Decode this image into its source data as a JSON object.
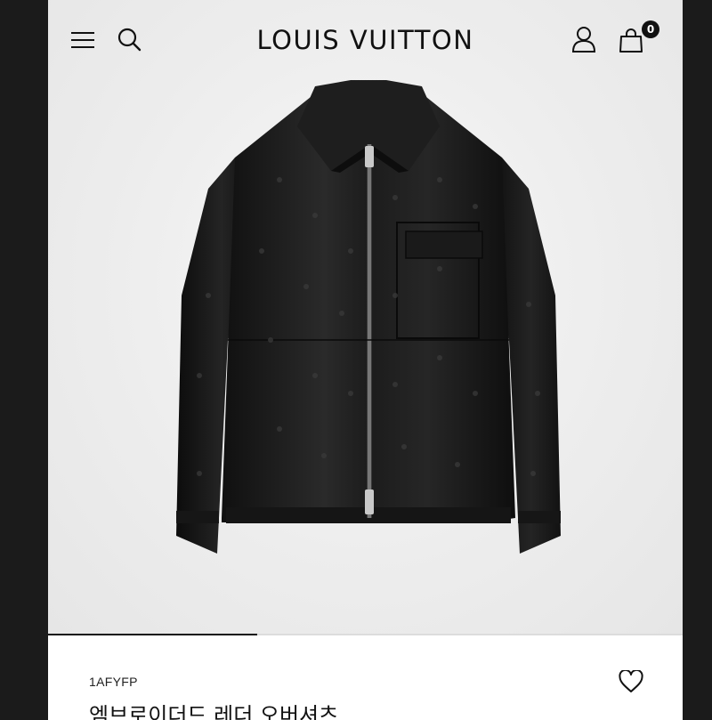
{
  "header": {
    "brand": "LOUIS VUITTON",
    "bag_count": "0",
    "icons": {
      "menu": "hamburger-menu-icon",
      "search": "search-icon",
      "account": "user-icon",
      "bag": "shopping-bag-icon"
    }
  },
  "gallery": {
    "progress_fraction": 0.33
  },
  "product": {
    "sku": "1AFYFP",
    "name": "엠브로이더드 레더 오버셔츠",
    "wishlist_icon": "heart-icon"
  },
  "colors": {
    "background_frame": "#1b1b1b",
    "hero_background": "#ededed",
    "text_primary": "#111111",
    "accent": "#111111"
  }
}
